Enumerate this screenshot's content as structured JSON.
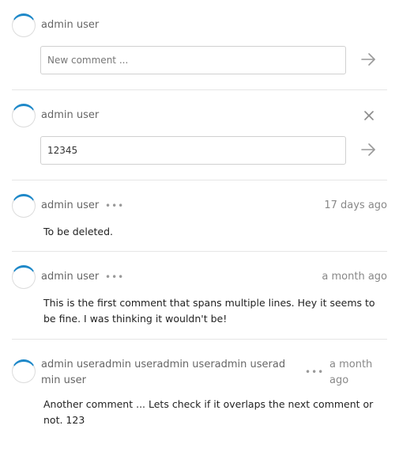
{
  "new_comment": {
    "user": "admin user",
    "placeholder": "New comment ..."
  },
  "edit_comment": {
    "user": "admin user",
    "value": "12345"
  },
  "comments": [
    {
      "user": "admin user",
      "more": "•••",
      "time": "17 days ago",
      "text": "To be deleted."
    },
    {
      "user": "admin user",
      "more": "•••",
      "time": "a month ago",
      "text": "This is the first comment that spans multiple lines. Hey it seems to be fine. I was thinking it wouldn't be!"
    },
    {
      "user": "admin useradmin useradmin useradmin useradmin user",
      "more": "•••",
      "time": "a month ago",
      "text": "Another comment ... Lets check if it overlaps the next comment or not. 123"
    }
  ],
  "icons": {
    "send": "arrow-right-icon",
    "cancel": "close-icon",
    "more": "more-dots-icon"
  },
  "colors": {
    "avatar_accent": "#1e88c8"
  }
}
